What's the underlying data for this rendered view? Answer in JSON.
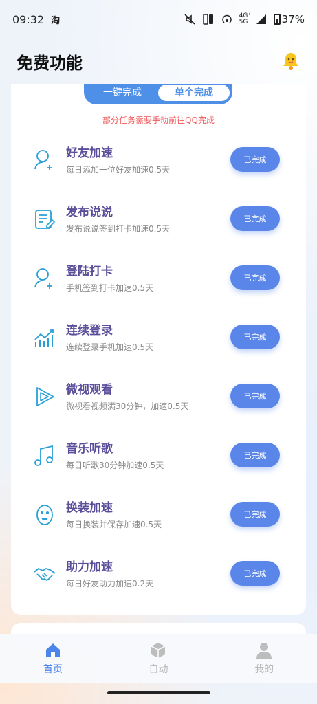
{
  "status": {
    "time": "09:32",
    "carrier_glyph": "淘",
    "network": "4G⁺ 5G",
    "battery": "37%"
  },
  "header": {
    "title": "免费功能"
  },
  "segment": {
    "option1": "一键完成",
    "option2": "单个完成"
  },
  "notice": "部分任务需要手动前往QQ完成",
  "tasks": [
    {
      "title": "好友加速",
      "desc": "每日添加一位好友加速0.5天",
      "button": "已完成",
      "icon": "add-friend-icon"
    },
    {
      "title": "发布说说",
      "desc": "发布说说签到打卡加速0.5天",
      "button": "已完成",
      "icon": "post-note-icon"
    },
    {
      "title": "登陆打卡",
      "desc": "手机签到打卡加速0.5天",
      "button": "已完成",
      "icon": "checkin-user-icon"
    },
    {
      "title": "连续登录",
      "desc": "连续登录手机加速0.5天",
      "button": "已完成",
      "icon": "growth-chart-icon"
    },
    {
      "title": "微视观看",
      "desc": "微视看视频满30分钟，加速0.5天",
      "button": "已完成",
      "icon": "play-icon"
    },
    {
      "title": "音乐听歌",
      "desc": "每日听歌30分钟加速0.5天",
      "button": "已完成",
      "icon": "music-note-icon"
    },
    {
      "title": "换装加速",
      "desc": "每日换装并保存加速0.5天",
      "button": "已完成",
      "icon": "avatar-face-icon"
    },
    {
      "title": "助力加速",
      "desc": "每日好友助力加速0.2天",
      "button": "已完成",
      "icon": "handshake-icon"
    }
  ],
  "nav": [
    {
      "label": "首页",
      "icon": "home-icon",
      "active": true
    },
    {
      "label": "自动",
      "icon": "cube-icon",
      "active": false
    },
    {
      "label": "我的",
      "icon": "profile-icon",
      "active": false
    }
  ],
  "colors": {
    "accent": "#5a86ea",
    "title_purple": "#5a4e9a",
    "notice_red": "#f0595b",
    "icon_teal": "#2a9fd6"
  }
}
